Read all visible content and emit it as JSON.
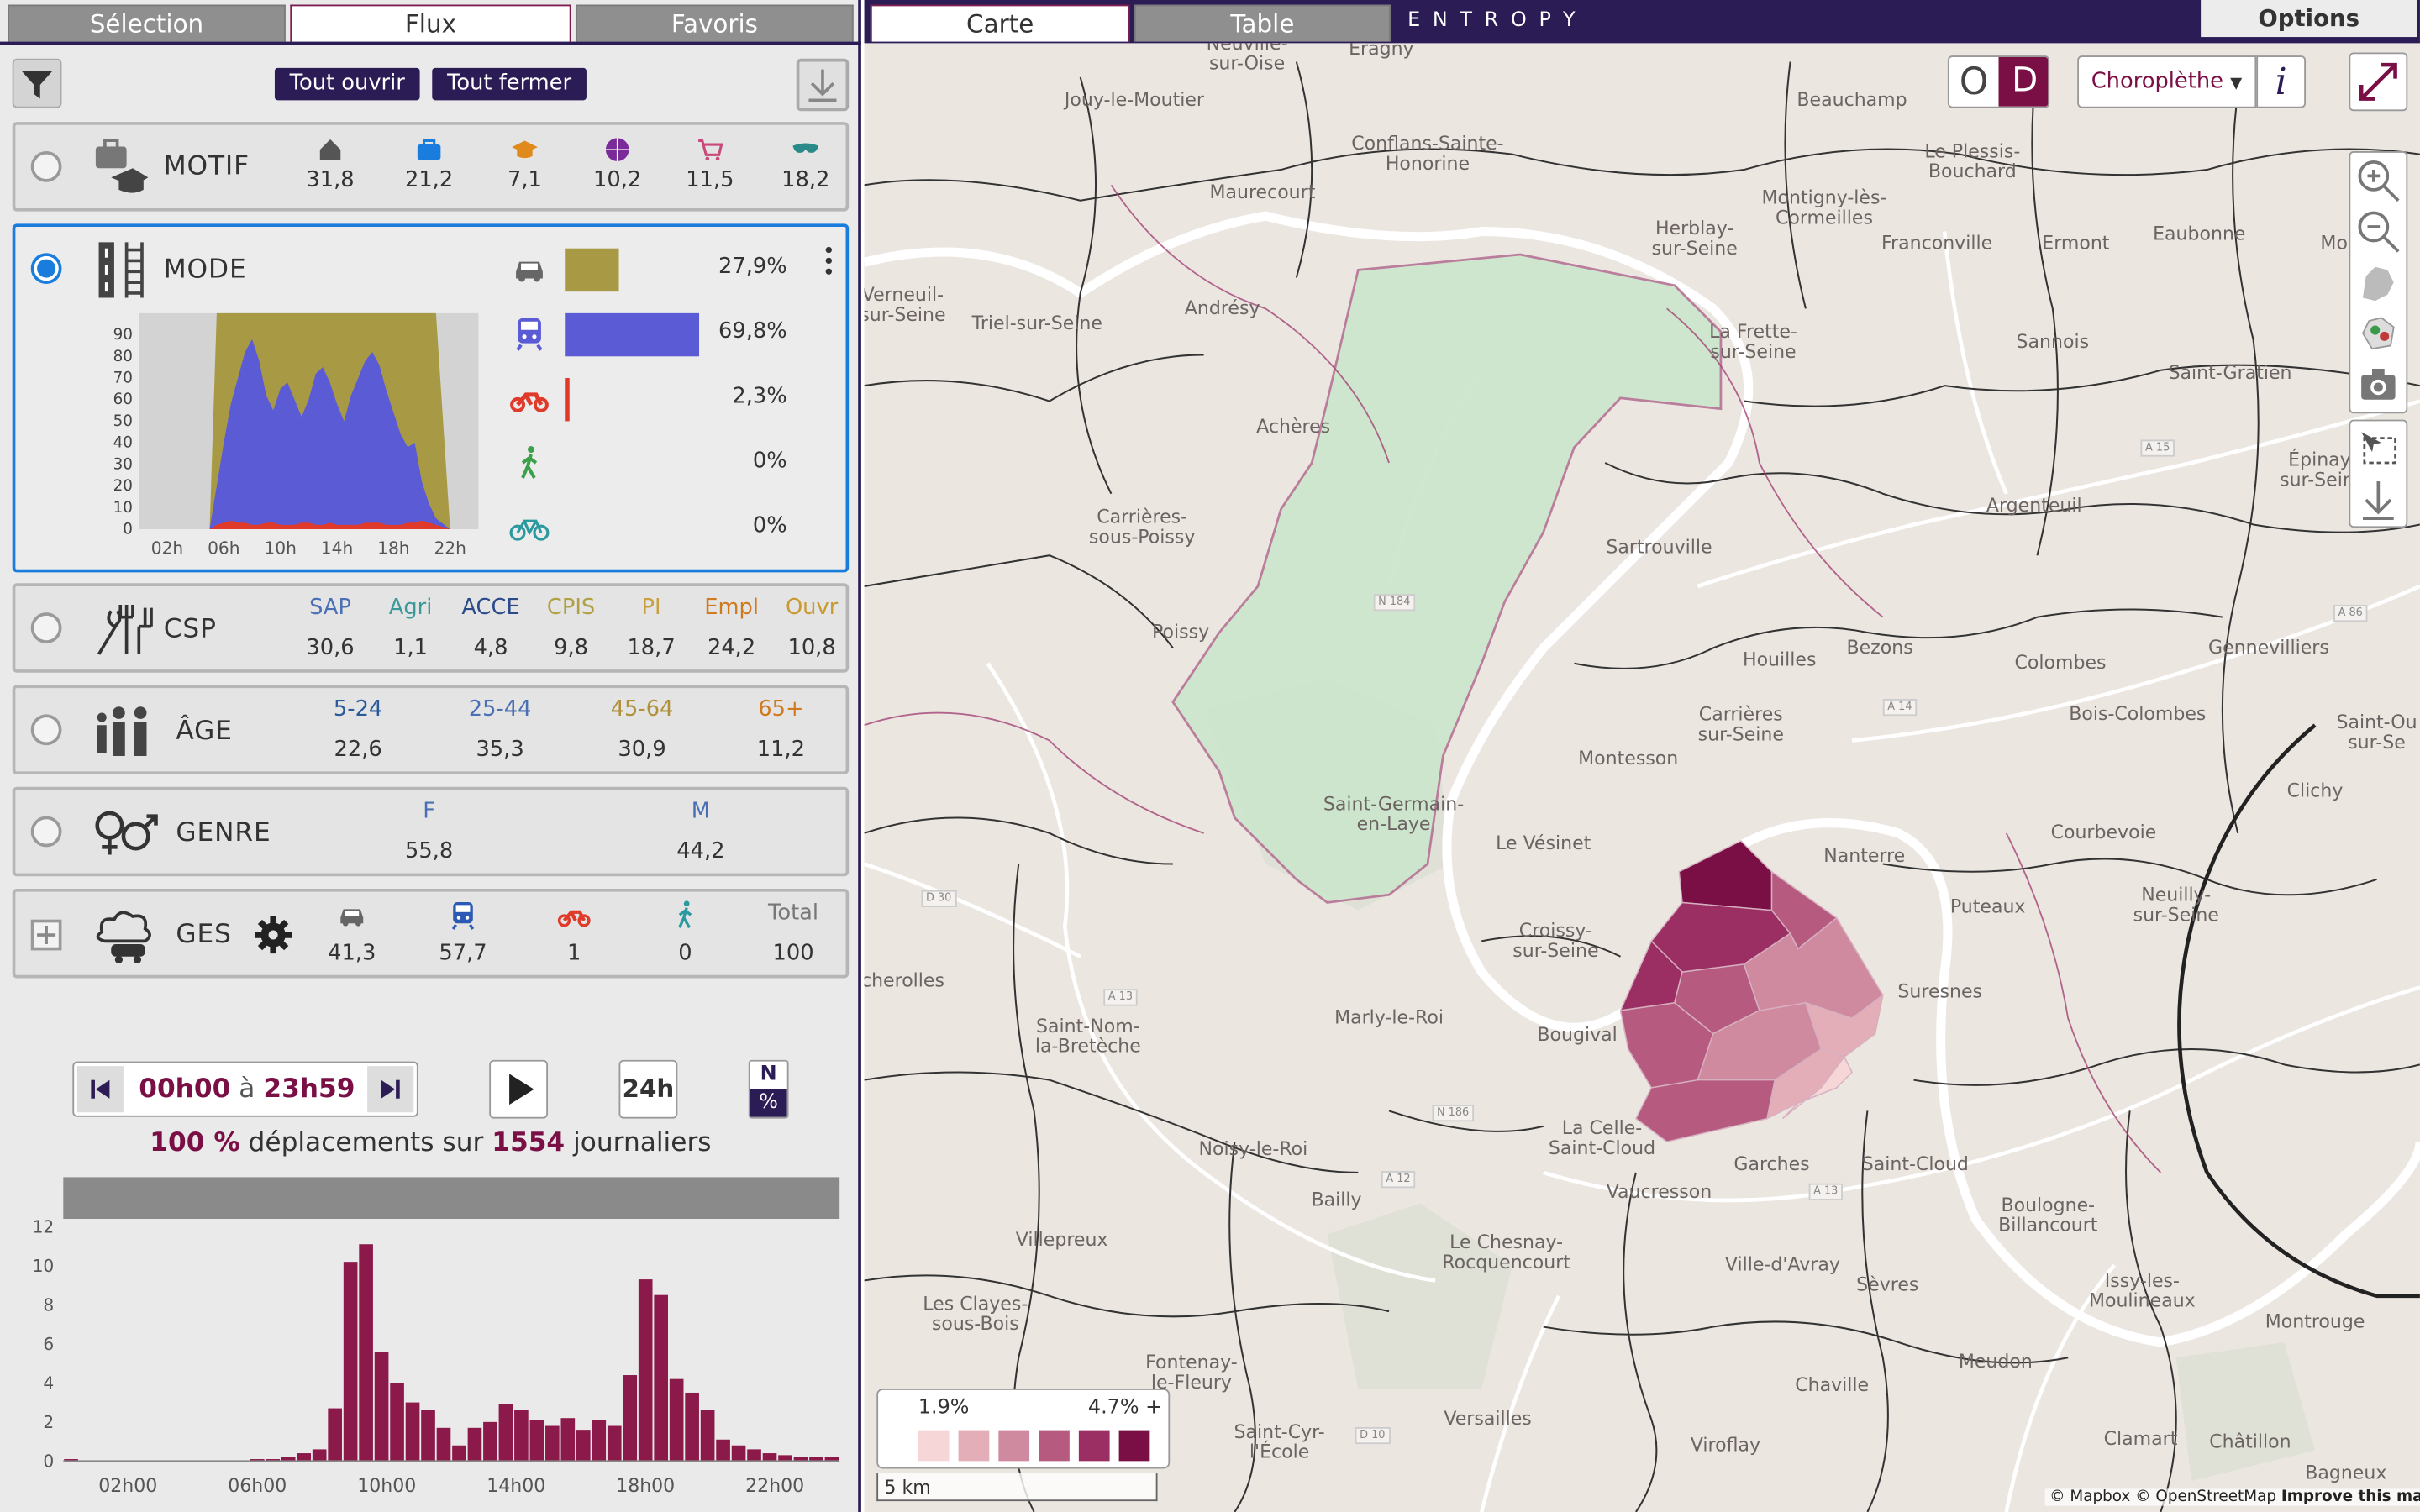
{
  "left_tabs": [
    "Sélection",
    "Flux",
    "Favoris"
  ],
  "actions": {
    "open_all": "Tout ouvrir",
    "close_all": "Tout fermer"
  },
  "motif": {
    "title": "MOTIF",
    "icons": [
      "home-icon",
      "briefcase-icon",
      "graduation-cap-icon",
      "ball-icon",
      "cart-icon",
      "mask-icon"
    ],
    "colors": [
      "#555555",
      "#1a7dde",
      "#e08a1e",
      "#7b2a9a",
      "#c84a7a",
      "#2a8a8a"
    ],
    "values": [
      "31,8",
      "21,2",
      "7,1",
      "10,2",
      "11,5",
      "18,2"
    ]
  },
  "mode": {
    "title": "MODE",
    "items": [
      {
        "icon": "car-icon",
        "color": "#a89a44",
        "share": 0.279,
        "label": "27,9%"
      },
      {
        "icon": "train-icon",
        "color": "#5b5bd6",
        "share": 0.698,
        "label": "69,8%"
      },
      {
        "icon": "motorbike-icon",
        "color": "#e03a2a",
        "share": 0.023,
        "label": "2,3%"
      },
      {
        "icon": "walker-icon",
        "color": "#3aa04a",
        "share": 0.0,
        "label": "0%"
      },
      {
        "icon": "bike-icon",
        "color": "#2a9aa0",
        "share": 0.0,
        "label": "0%"
      }
    ],
    "chart_data": {
      "type": "area",
      "x_ticks": [
        "02h",
        "06h",
        "10h",
        "14h",
        "18h",
        "22h"
      ],
      "y_ticks": [
        "90",
        "80",
        "70",
        "60",
        "50",
        "40",
        "30",
        "20",
        "10",
        "0"
      ],
      "ylim": [
        0,
        100
      ],
      "hours": [
        0,
        5,
        5.5,
        6,
        6.5,
        7,
        7.5,
        8,
        8.5,
        9,
        9.5,
        10,
        10.5,
        11,
        11.5,
        12,
        12.5,
        13,
        13.5,
        14,
        14.5,
        15,
        15.5,
        16,
        16.5,
        17,
        17.5,
        18,
        18.5,
        19,
        19.5,
        20,
        20.5,
        21,
        22
      ],
      "series": [
        {
          "icon": "motorbike-icon",
          "values": [
            0,
            0,
            2,
            3,
            4,
            3,
            3,
            2,
            2,
            3,
            3,
            2,
            2,
            2,
            3,
            3,
            2,
            2,
            3,
            2,
            2,
            2,
            2,
            3,
            3,
            3,
            2,
            2,
            2,
            3,
            3,
            4,
            3,
            2,
            0
          ]
        },
        {
          "icon": "train-icon",
          "values": [
            0,
            0,
            20,
            40,
            58,
            70,
            82,
            88,
            78,
            62,
            55,
            65,
            68,
            60,
            52,
            60,
            72,
            75,
            68,
            58,
            50,
            62,
            70,
            78,
            82,
            76,
            64,
            54,
            44,
            38,
            40,
            22,
            12,
            5,
            0
          ]
        },
        {
          "icon": "car-icon",
          "values": [
            0,
            0,
            100,
            100,
            100,
            100,
            100,
            100,
            100,
            100,
            100,
            100,
            100,
            100,
            100,
            100,
            100,
            100,
            100,
            100,
            100,
            100,
            100,
            100,
            100,
            100,
            100,
            100,
            100,
            100,
            100,
            100,
            100,
            100,
            0
          ]
        }
      ]
    }
  },
  "csp": {
    "title": "CSP",
    "headers": [
      "SAP",
      "Agri",
      "ACCE",
      "CPIS",
      "PI",
      "Empl",
      "Ouvr"
    ],
    "colors": [
      "#4a6fb5",
      "#3a9a9a",
      "#2a4a8a",
      "#b0a040",
      "#c8a040",
      "#d07a20",
      "#c89a30"
    ],
    "values": [
      "30,6",
      "1,1",
      "4,8",
      "9,8",
      "18,7",
      "24,2",
      "10,8"
    ]
  },
  "age": {
    "title": "ÂGE",
    "headers": [
      "5-24",
      "25-44",
      "45-64",
      "65+"
    ],
    "colors": [
      "#2a5a9a",
      "#4a6fb5",
      "#b0903a",
      "#d07a20"
    ],
    "values": [
      "22,6",
      "35,3",
      "30,9",
      "11,2"
    ]
  },
  "genre": {
    "title": "GENRE",
    "headers": [
      "F",
      "M"
    ],
    "colors": [
      "#4a6fb5",
      "#4a6fb5"
    ],
    "values": [
      "55,8",
      "44,2"
    ]
  },
  "ges": {
    "title": "GES",
    "icons": [
      "car-icon",
      "train-icon",
      "motorbike-icon",
      "walker-icon"
    ],
    "total_label": "Total",
    "values": [
      "41,3",
      "57,7",
      "1",
      "0",
      "100"
    ]
  },
  "time": {
    "start": "00h00",
    "sep": "à",
    "end": "23h59",
    "period": "24h",
    "unit_top": "N",
    "unit_bottom": "%"
  },
  "summary": {
    "pct": "100 %",
    "text1": "déplacements sur",
    "count": "1554",
    "text2": "journaliers"
  },
  "hist": {
    "chart_data": {
      "type": "bar",
      "x_ticks": [
        "02h00",
        "06h00",
        "10h00",
        "14h00",
        "18h00",
        "22h00"
      ],
      "y_ticks": [
        "12",
        "10",
        "8",
        "6",
        "4",
        "2",
        "0"
      ],
      "ylim": [
        0,
        12.4
      ],
      "color": "#8b1a4a",
      "values": [
        0.1,
        0,
        0,
        0,
        0,
        0,
        0,
        0,
        0,
        0,
        0,
        0,
        0.1,
        0.1,
        0.2,
        0.4,
        0.6,
        2.7,
        10.2,
        11.1,
        5.6,
        4,
        3,
        2.6,
        1.7,
        0.8,
        1.7,
        2,
        2.9,
        2.6,
        2.1,
        1.8,
        2.2,
        1.6,
        2.1,
        1.8,
        4.4,
        9.3,
        8.5,
        4.2,
        3.5,
        2.6,
        1.1,
        0.8,
        0.6,
        0.4,
        0.3,
        0.2,
        0.2,
        0.2
      ]
    }
  },
  "map_tabs": [
    "Carte",
    "Table"
  ],
  "brand": "ENTROPY",
  "options_label": "Options",
  "od": {
    "o": "O",
    "d": "D"
  },
  "map_mode": "Choroplèthe",
  "info_label": "i",
  "legend": {
    "min": "1.9%",
    "max": "4.7% +",
    "colors": [
      "#f6d6d6",
      "#e4aeb8",
      "#d08aa0",
      "#b65a80",
      "#9b2e62",
      "#7a0f46"
    ],
    "scale": "5 km"
  },
  "attribution": {
    "a": "© Mapbox",
    "b": "© OpenStreetMap",
    "c": "Improve this map"
  },
  "towns": [
    {
      "n": "Neuville-\nsur-Oise",
      "x": 808,
      "y": 35
    },
    {
      "n": "Eragny",
      "x": 895,
      "y": 32
    },
    {
      "n": "Jouy-le-Moutier",
      "x": 735,
      "y": 65
    },
    {
      "n": "Conflans-Sainte-\nHonorine",
      "x": 925,
      "y": 100
    },
    {
      "n": "Maurecourt",
      "x": 818,
      "y": 125
    },
    {
      "n": "Beauchamp",
      "x": 1200,
      "y": 65
    },
    {
      "n": "Le Plessis-\nBouchard",
      "x": 1278,
      "y": 105
    },
    {
      "n": "Herblay-\nsur-Seine",
      "x": 1098,
      "y": 155
    },
    {
      "n": "Montigny-lès-\nCormeilles",
      "x": 1182,
      "y": 135
    },
    {
      "n": "Franconville",
      "x": 1255,
      "y": 158
    },
    {
      "n": "Ermont",
      "x": 1345,
      "y": 158
    },
    {
      "n": "Eaubonne",
      "x": 1425,
      "y": 152
    },
    {
      "n": "Montmo",
      "x": 1528,
      "y": 158
    },
    {
      "n": "Verneuil-\nsur-Seine",
      "x": 585,
      "y": 198
    },
    {
      "n": "Triel-sur-Seine",
      "x": 672,
      "y": 210
    },
    {
      "n": "Andrésy",
      "x": 792,
      "y": 200
    },
    {
      "n": "La Frette-\nsur-Seine",
      "x": 1136,
      "y": 222
    },
    {
      "n": "Sannois",
      "x": 1330,
      "y": 222
    },
    {
      "n": "Saint-Gratien",
      "x": 1445,
      "y": 242
    },
    {
      "n": "Achères",
      "x": 838,
      "y": 277
    },
    {
      "n": "Argenteuil",
      "x": 1318,
      "y": 328
    },
    {
      "n": "Épinay-\nsur-Seine",
      "x": 1505,
      "y": 305
    },
    {
      "n": "Carrières-\nsous-Poissy",
      "x": 740,
      "y": 342
    },
    {
      "n": "Sartrouville",
      "x": 1075,
      "y": 355
    },
    {
      "n": "Poissy",
      "x": 765,
      "y": 410
    },
    {
      "n": "Houilles",
      "x": 1153,
      "y": 428
    },
    {
      "n": "Bezons",
      "x": 1218,
      "y": 420
    },
    {
      "n": "Colombes",
      "x": 1335,
      "y": 430
    },
    {
      "n": "Gennevilliers",
      "x": 1470,
      "y": 420
    },
    {
      "n": "Bois-Colombes",
      "x": 1385,
      "y": 463
    },
    {
      "n": "Saint-Ou\nsur-Se",
      "x": 1540,
      "y": 475
    },
    {
      "n": "Carrières\nsur-Seine",
      "x": 1128,
      "y": 470
    },
    {
      "n": "Montesson",
      "x": 1055,
      "y": 492
    },
    {
      "n": "Saint-Germain-\nen-Laye",
      "x": 903,
      "y": 528
    },
    {
      "n": "Le Vésinet",
      "x": 1000,
      "y": 547
    },
    {
      "n": "Nanterre",
      "x": 1208,
      "y": 555
    },
    {
      "n": "Courbevoie",
      "x": 1363,
      "y": 540
    },
    {
      "n": "Clichy",
      "x": 1500,
      "y": 513
    },
    {
      "n": "Puteaux",
      "x": 1288,
      "y": 588
    },
    {
      "n": "Neuilly-\nsur-Seine",
      "x": 1410,
      "y": 587
    },
    {
      "n": "Croissy-\nsur-Seine",
      "x": 1008,
      "y": 610
    },
    {
      "n": "Suresnes",
      "x": 1257,
      "y": 643
    },
    {
      "n": "cherolles",
      "x": 585,
      "y": 636
    },
    {
      "n": "Saint-Nom-\nla-Bretèche",
      "x": 705,
      "y": 672
    },
    {
      "n": "Marly-le-Roi",
      "x": 900,
      "y": 660
    },
    {
      "n": "Bougival",
      "x": 1022,
      "y": 671
    },
    {
      "n": "La Celle-\nSaint-Cloud",
      "x": 1038,
      "y": 738
    },
    {
      "n": "Garches",
      "x": 1148,
      "y": 755
    },
    {
      "n": "Saint-Cloud",
      "x": 1241,
      "y": 755
    },
    {
      "n": "Noisy-le-Roi",
      "x": 812,
      "y": 745
    },
    {
      "n": "Vaucresson",
      "x": 1075,
      "y": 773
    },
    {
      "n": "Bailly",
      "x": 866,
      "y": 778
    },
    {
      "n": "Boulogne-\nBillancourt",
      "x": 1327,
      "y": 788
    },
    {
      "n": "Villepreux",
      "x": 688,
      "y": 804
    },
    {
      "n": "Le Chesnay-\nRocquencourt",
      "x": 976,
      "y": 812
    },
    {
      "n": "Ville-d'Avray",
      "x": 1155,
      "y": 820
    },
    {
      "n": "Sèvres",
      "x": 1223,
      "y": 833
    },
    {
      "n": "Issy-les-\nMoulineaux",
      "x": 1388,
      "y": 837
    },
    {
      "n": "Les Clayes-\nsous-Bois",
      "x": 632,
      "y": 852
    },
    {
      "n": "Montrouge",
      "x": 1500,
      "y": 857
    },
    {
      "n": "Fontenay-\nle-Fleury",
      "x": 772,
      "y": 890
    },
    {
      "n": "Meudon",
      "x": 1293,
      "y": 883
    },
    {
      "n": "Chaville",
      "x": 1187,
      "y": 898
    },
    {
      "n": "Versailles",
      "x": 964,
      "y": 920
    },
    {
      "n": "Saint-Cyr-\nl'École",
      "x": 829,
      "y": 935
    },
    {
      "n": "Viroflay",
      "x": 1118,
      "y": 937
    },
    {
      "n": "Clamart",
      "x": 1387,
      "y": 933
    },
    {
      "n": "Châtillon",
      "x": 1458,
      "y": 935
    },
    {
      "n": "Bagneux",
      "x": 1520,
      "y": 955
    }
  ]
}
